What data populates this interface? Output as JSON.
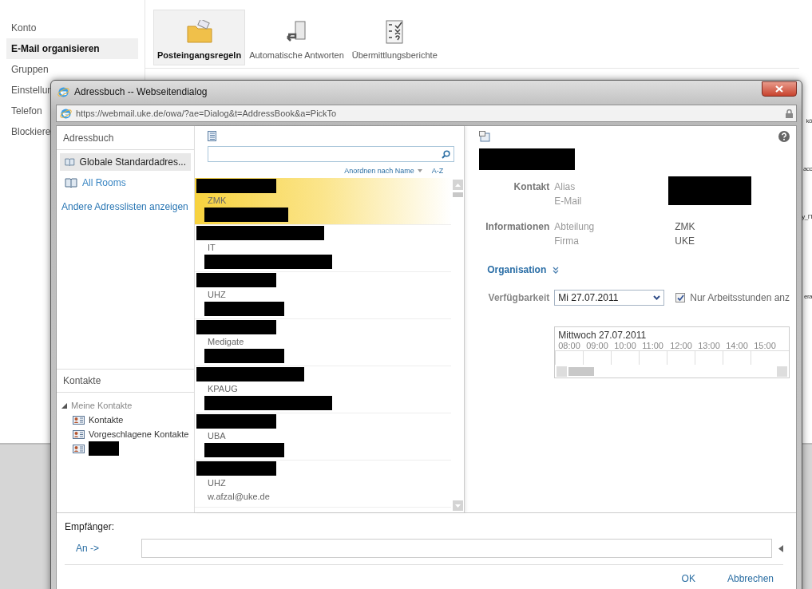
{
  "nav": {
    "items": [
      {
        "label": "Konto",
        "selected": false
      },
      {
        "label": "E-Mail organisieren",
        "selected": true
      },
      {
        "label": "Gruppen",
        "selected": false
      },
      {
        "label": "Einstellun",
        "selected": false
      },
      {
        "label": "Telefon",
        "selected": false
      },
      {
        "label": "Blockiere",
        "selected": false
      }
    ]
  },
  "ribbon": {
    "buttons": [
      {
        "label": "Posteingangsregeln",
        "kind": "folder",
        "selected": true
      },
      {
        "label": "Automatische Antworten",
        "kind": "door",
        "selected": false
      },
      {
        "label": "Übermittlungsberichte",
        "kind": "checklist",
        "selected": false
      }
    ]
  },
  "background_fragments": [
    "kö",
    "acc",
    "y_П",
    "era"
  ],
  "dialog": {
    "title": "Adressbuch -- Webseitendialog",
    "url": "https://webmail.uke.de/owa/?ae=Dialog&t=AddressBook&a=PickTo",
    "address_books": {
      "header": "Adressbuch",
      "items": [
        {
          "label": "Globale Standardadres...",
          "selected": true
        },
        {
          "label": "All Rooms",
          "selected": false
        }
      ],
      "link": "Andere Adresslisten anzeigen"
    },
    "contacts": {
      "header": "Kontakte",
      "tree": [
        {
          "label": "Meine Kontakte",
          "expanded": true,
          "children": [
            {
              "kind": "folder",
              "label": "Kontakte"
            },
            {
              "kind": "folder",
              "label": "Vorgeschlagene Kontakte"
            },
            {
              "kind": "redacted"
            }
          ]
        }
      ]
    },
    "sort": {
      "label": "Anordnen nach Name",
      "order": "A-Z"
    },
    "results": [
      {
        "department": "ZMK",
        "selected": true
      },
      {
        "department": "IT",
        "selected": false
      },
      {
        "department": "UHZ",
        "selected": false
      },
      {
        "department": "Medigate",
        "selected": false
      },
      {
        "department": "KPAUG",
        "selected": false
      },
      {
        "department": "UBA",
        "selected": false
      },
      {
        "department": "UHZ",
        "selected": false,
        "email": "w.afzal@uke.de"
      }
    ],
    "details": {
      "sections": [
        {
          "heading": "Kontakt",
          "fields": [
            {
              "label": "Alias",
              "kind": "redacted"
            },
            {
              "label": "E-Mail",
              "kind": "redacted-continued"
            }
          ]
        },
        {
          "heading": "Informationen",
          "fields": [
            {
              "label": "Abteilung",
              "kind": "text",
              "value": "ZMK"
            },
            {
              "label": "Firma",
              "kind": "text",
              "value": "UKE"
            }
          ]
        }
      ],
      "organisation": "Organisation",
      "availability": {
        "label": "Verfügbarkeit",
        "date": "Mi 27.07.2011",
        "checkbox": {
          "label": "Nur Arbeitsstunden anz",
          "checked": true
        }
      },
      "timeline": {
        "day": "Mittwoch 27.07.2011",
        "hours": [
          "08:00",
          "09:00",
          "10:00",
          "11:00",
          "12:00",
          "13:00",
          "14:00",
          "15:00"
        ]
      }
    },
    "recipients": {
      "label": "Empfänger:",
      "to": "An ->"
    },
    "buttons": [
      "OK",
      "Abbrechen"
    ]
  }
}
